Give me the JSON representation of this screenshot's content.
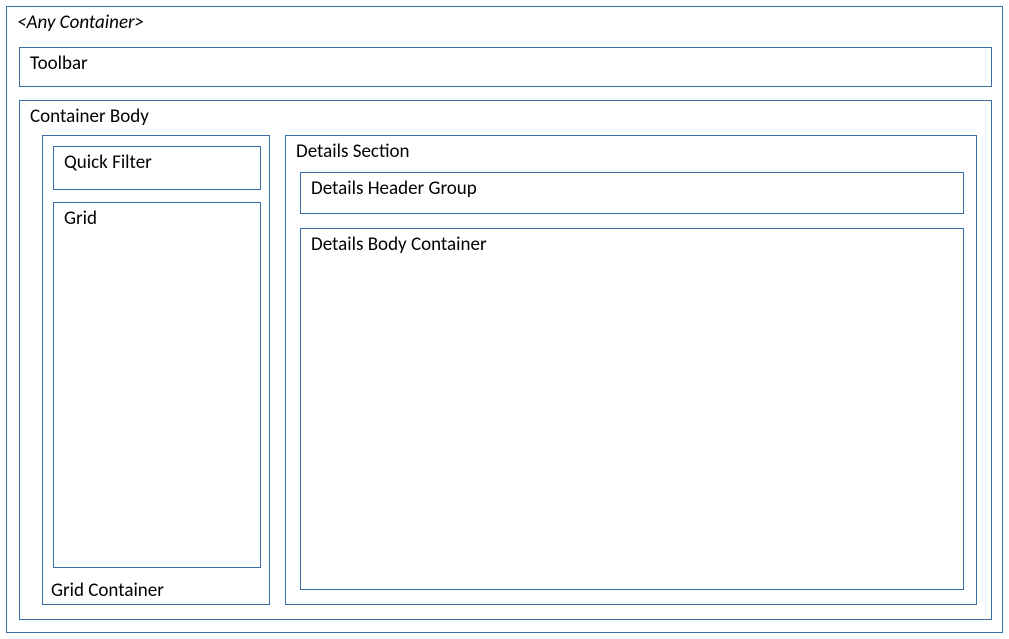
{
  "outer": {
    "label": "<Any Container>"
  },
  "toolbar": {
    "label": "Toolbar"
  },
  "container_body": {
    "label": "Container Body"
  },
  "grid_container": {
    "label": "Grid Container"
  },
  "quick_filter": {
    "label": "Quick Filter"
  },
  "grid": {
    "label": "Grid"
  },
  "details_section": {
    "label": "Details Section"
  },
  "details_header_group": {
    "label": "Details Header Group"
  },
  "details_body_container": {
    "label": "Details Body Container"
  }
}
